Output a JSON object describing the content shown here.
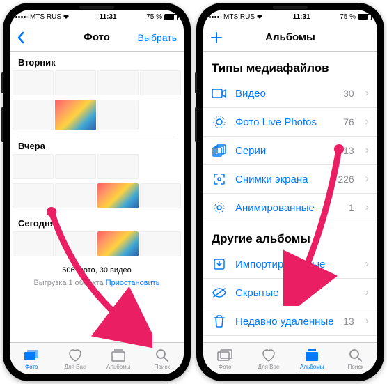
{
  "status": {
    "carrier": "MTS RUS",
    "time": "11:31",
    "battery_pct": "75 %"
  },
  "left": {
    "title": "Фото",
    "select": "Выбрать",
    "sections": {
      "tue": "Вторник",
      "yest": "Вчера",
      "today": "Сегодня"
    },
    "summary": "506 фото, 30 видео",
    "upload_prefix": "Выгрузка 1 объекта  ",
    "upload_action": "Приостановить"
  },
  "right": {
    "title": "Альбомы",
    "section1": "Типы медиафайлов",
    "section2": "Другие альбомы",
    "rows": {
      "video": {
        "label": "Видео",
        "count": "30"
      },
      "live": {
        "label": "Фото Live Photos",
        "count": "76"
      },
      "burst": {
        "label": "Серии",
        "count": "13"
      },
      "screenshots": {
        "label": "Снимки экрана",
        "count": "226"
      },
      "animated": {
        "label": "Анимированные",
        "count": "1"
      },
      "imported": {
        "label": "Импортированные",
        "count": ""
      },
      "hidden": {
        "label": "Скрытые",
        "count": ""
      },
      "deleted": {
        "label": "Недавно удаленные",
        "count": "13"
      }
    }
  },
  "tabs": {
    "photos": "Фото",
    "foryou": "Для Вас",
    "albums": "Альбомы",
    "search": "Поиск"
  }
}
